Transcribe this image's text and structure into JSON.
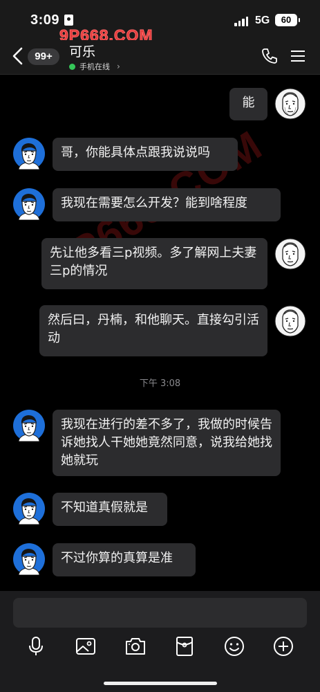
{
  "status_bar": {
    "time": "3:09",
    "network": "5G",
    "battery": "60"
  },
  "watermark": {
    "site": "9P668.COM",
    "diagonal": "9P668.COM"
  },
  "header": {
    "unread_count": "99+",
    "contact_name": "可乐",
    "online_status": "手机在线",
    "chevron": "›"
  },
  "messages": [
    {
      "side": "right",
      "text": "能"
    },
    {
      "side": "left",
      "text": "哥，你能具体点跟我说说吗"
    },
    {
      "side": "left",
      "text": "我现在需要怎么开发？能到啥程度"
    },
    {
      "side": "right",
      "text": "先让他多看三p视频。多了解网上夫妻三p的情况"
    },
    {
      "side": "right",
      "text": "然后曰，丹楠，和他聊天。直接勾引活动"
    },
    {
      "side": "left",
      "text": "我现在进行的差不多了，我做的时候告诉她找人干她她竟然同意，说我给她找她就玩"
    },
    {
      "side": "left",
      "text": "不知道真假就是"
    },
    {
      "side": "left",
      "text": "不过你算的真算是准"
    }
  ],
  "timestamp": "下午 3:08",
  "colors": {
    "online": "#35c759",
    "bubble": "#2c2c2e",
    "contact_avatar_bg": "#1e6fd9",
    "watermark": "#e23a3a"
  },
  "toolbar": [
    "microphone-icon",
    "image-icon",
    "camera-icon",
    "red-packet-icon",
    "emoji-icon",
    "plus-icon"
  ]
}
